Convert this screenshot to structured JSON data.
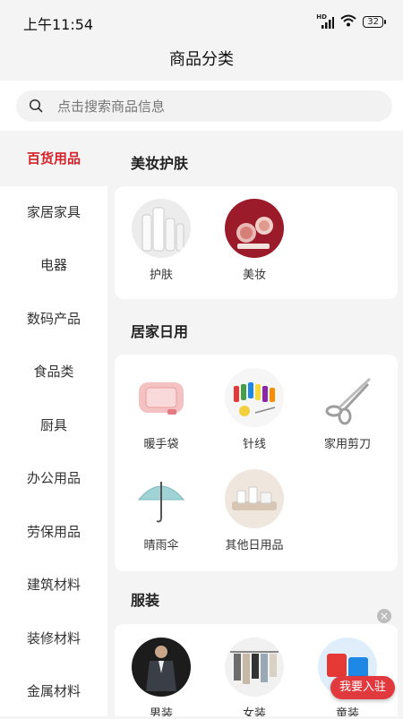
{
  "status": {
    "time": "上午11:54",
    "signal": "HD",
    "battery": "32"
  },
  "header": {
    "title": "商品分类"
  },
  "search": {
    "placeholder": "点击搜索商品信息"
  },
  "sidebar": {
    "items": [
      {
        "label": "百货用品"
      },
      {
        "label": "家居家具"
      },
      {
        "label": "电器"
      },
      {
        "label": "数码产品"
      },
      {
        "label": "食品类"
      },
      {
        "label": "厨具"
      },
      {
        "label": "办公用品"
      },
      {
        "label": "劳保用品"
      },
      {
        "label": "建筑材料"
      },
      {
        "label": "装修材料"
      },
      {
        "label": "金属材料"
      }
    ],
    "active_index": 0
  },
  "sections": [
    {
      "title": "美妆护肤",
      "items": [
        {
          "label": "护肤",
          "icon": "skincare-bottles"
        },
        {
          "label": "美妆",
          "icon": "makeup-palette"
        }
      ]
    },
    {
      "title": "居家日用",
      "items": [
        {
          "label": "暖手袋",
          "icon": "hand-warmer"
        },
        {
          "label": "针线",
          "icon": "sewing-kit"
        },
        {
          "label": "家用剪刀",
          "icon": "scissors"
        },
        {
          "label": "晴雨伞",
          "icon": "umbrella"
        },
        {
          "label": "其他日用品",
          "icon": "bathroom-set"
        }
      ]
    },
    {
      "title": "服装",
      "items": [
        {
          "label": "男装",
          "icon": "mens-suit"
        },
        {
          "label": "女装",
          "icon": "womens-clothes"
        },
        {
          "label": "童装",
          "icon": "kids-clothes"
        }
      ]
    }
  ],
  "float": {
    "join_label": "我要入驻",
    "close_label": "×"
  },
  "colors": {
    "accent": "#d2232a",
    "background": "#f4f4f4",
    "card": "#ffffff"
  }
}
